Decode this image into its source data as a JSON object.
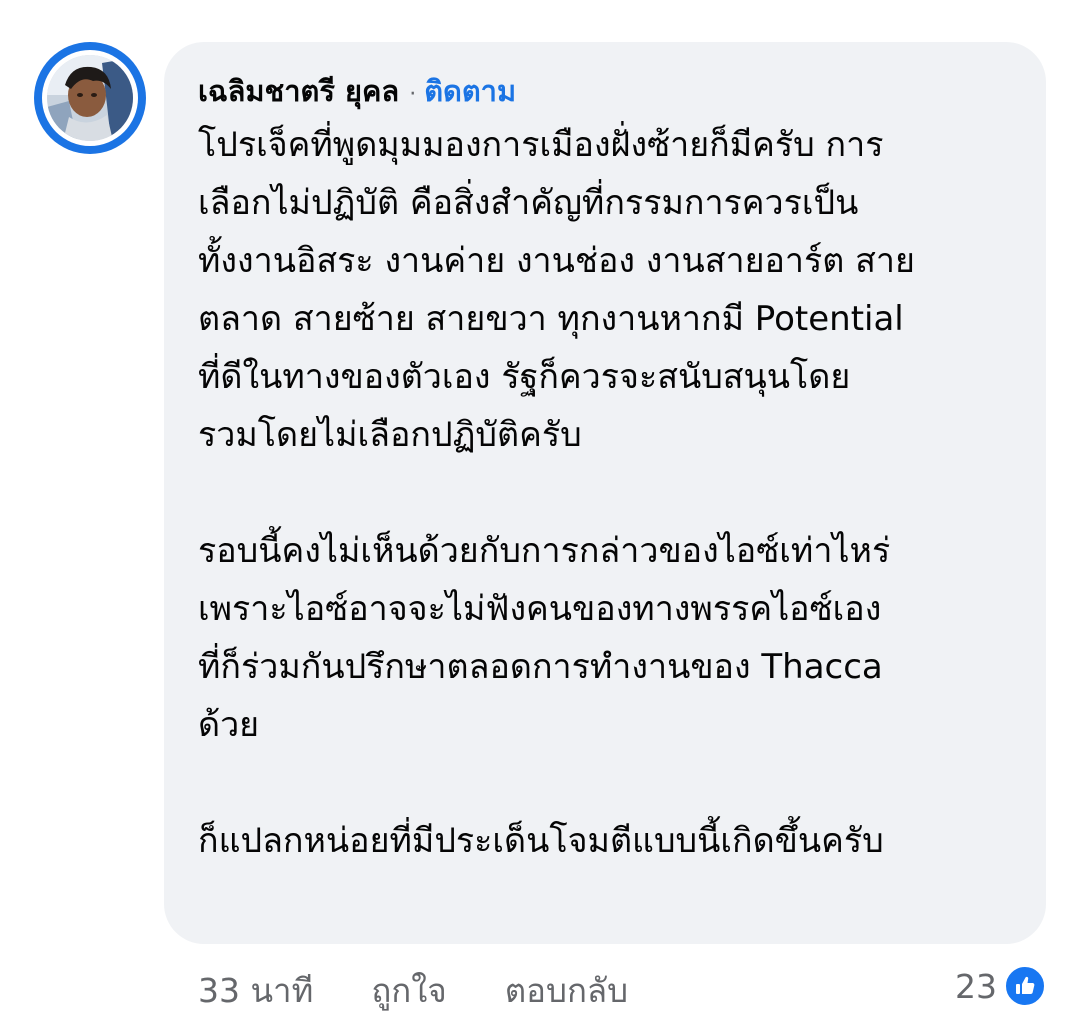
{
  "comment": {
    "author": "เฉลิมชาตรี ยุคล",
    "separator": "·",
    "follow_label": "ติดตาม",
    "paragraphs": [
      [
        "โปรเจ็คที่พูดมุมมองการเมืองฝั่งซ้ายก็มีครับ การ",
        "เลือกไม่ปฏิบัติ คือสิ่งสำคัญที่กรรมการควรเป็น",
        "ทั้งงานอิสระ งานค่าย งานช่อง งานสายอาร์ต สาย",
        "ตลาด สายซ้าย สายขวา ทุกงานหากมี Potential",
        "ที่ดีในทางของตัวเอง รัฐก็ควรจะสนับสนุนโดย",
        "รวมโดยไม่เลือกปฏิบัติครับ"
      ],
      [
        "รอบนี้คงไม่เห็นด้วยกับการกล่าวของไอซ์เท่าไหร่",
        "เพราะไอซ์อาจจะไม่ฟังคนของทางพรรคไอซ์เอง",
        "ที่ก็ร่วมกันปรึกษาตลอดการทำงานของ Thacca",
        "ด้วย"
      ],
      [
        "ก็แปลกหน่อยที่มีประเด็นโจมตีแบบนี้เกิดขึ้นครับ"
      ]
    ]
  },
  "footer": {
    "time": "33 นาที",
    "like_label": "ถูกใจ",
    "reply_label": "ตอบกลับ",
    "reaction_count": "23",
    "reaction_icon": "like-thumb-icon"
  },
  "colors": {
    "accent": "#1b74e4",
    "bubble": "#f0f2f5",
    "secondary_text": "#65676b",
    "like_badge": "#1877f2"
  }
}
